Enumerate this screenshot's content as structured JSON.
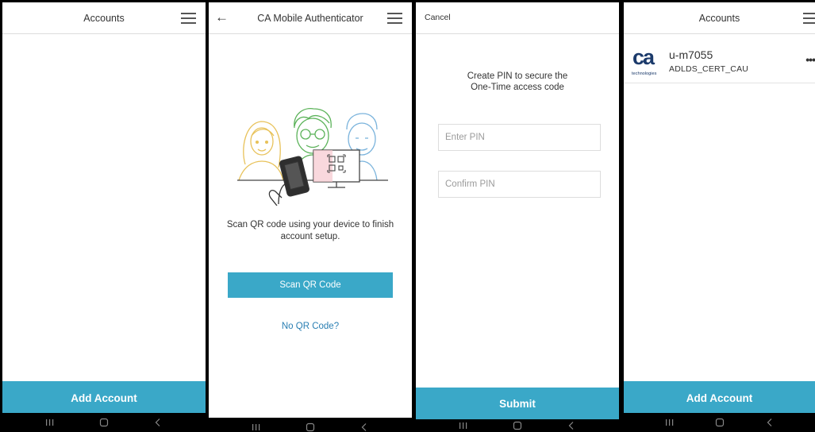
{
  "screens": [
    {
      "title": "Accounts",
      "bottom_action": "Add Account"
    },
    {
      "title": "CA Mobile Authenticator",
      "instruction": "Scan QR code using your device to finish account setup.",
      "scan_button": "Scan QR Code",
      "no_qr_link": "No QR Code?"
    },
    {
      "cancel": "Cancel",
      "instruction_line1": "Create PIN to secure the",
      "instruction_line2": "One-Time access code",
      "enter_pin_placeholder": "Enter PIN",
      "confirm_pin_placeholder": "Confirm PIN",
      "submit": "Submit"
    },
    {
      "title": "Accounts",
      "account": {
        "name": "u-m7055",
        "subtitle": "ADLDS_CERT_CAU",
        "logo_text": "ca",
        "logo_subtext": "technologies"
      },
      "bottom_action": "Add Account"
    }
  ],
  "icons": {
    "menu": "hamburger-menu-icon",
    "back": "back-arrow-icon",
    "more": "more-horizontal-icon",
    "nav_recents": "recents-icon",
    "nav_home": "home-icon",
    "nav_back": "nav-back-icon"
  },
  "colors": {
    "accent": "#3aa8c8",
    "link": "#2a7fb3",
    "logo": "#1b3a6b",
    "navbar": "#000000"
  }
}
